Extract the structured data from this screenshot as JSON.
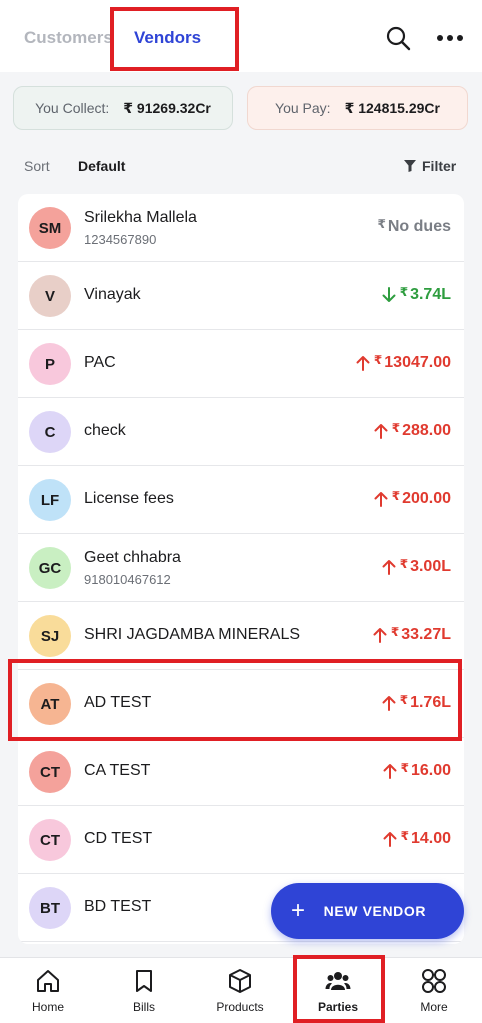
{
  "tabs": {
    "customers": "Customers",
    "vendors": "Vendors"
  },
  "summary": {
    "collect_label": "You Collect:",
    "collect_value": "₹ 91269.32Cr",
    "pay_label": "You Pay:",
    "pay_value": "₹ 124815.29Cr"
  },
  "sort": {
    "label": "Sort",
    "value": "Default",
    "filter_label": "Filter"
  },
  "icons": {
    "search": "search-icon",
    "more": "more-icon",
    "filter": "filter-icon",
    "fab": "plus-icon"
  },
  "colors": {
    "accent": "#2f44d6",
    "outflow": "#e03a2f",
    "inflow": "#2e9d3f",
    "highlight": "#e01f24"
  },
  "vendors": [
    {
      "initials": "SM",
      "name": "Srilekha Mallela",
      "phone": "1234567890",
      "amount": "No dues",
      "direction": "none",
      "avatar_color": "#f4a29b"
    },
    {
      "initials": "V",
      "name": "Vinayak",
      "phone": "",
      "amount": "3.74L",
      "direction": "down",
      "avatar_color": "#e8cfc8"
    },
    {
      "initials": "P",
      "name": "PAC",
      "phone": "",
      "amount": "13047.00",
      "direction": "up",
      "avatar_color": "#f8c8dc"
    },
    {
      "initials": "C",
      "name": "check",
      "phone": "",
      "amount": "288.00",
      "direction": "up",
      "avatar_color": "#ddd6f7"
    },
    {
      "initials": "LF",
      "name": "License fees",
      "phone": "",
      "amount": "200.00",
      "direction": "up",
      "avatar_color": "#bfe2f8"
    },
    {
      "initials": "GC",
      "name": "Geet chhabra",
      "phone": "918010467612",
      "amount": "3.00L",
      "direction": "up",
      "avatar_color": "#c9efc2"
    },
    {
      "initials": "SJ",
      "name": "SHRI JAGDAMBA MINERALS",
      "phone": "",
      "amount": "33.27L",
      "direction": "up",
      "avatar_color": "#f9dc9a"
    },
    {
      "initials": "AT",
      "name": "AD TEST",
      "phone": "",
      "amount": "1.76L",
      "direction": "up",
      "avatar_color": "#f6b592"
    },
    {
      "initials": "CT",
      "name": "CA TEST",
      "phone": "",
      "amount": "16.00",
      "direction": "up",
      "avatar_color": "#f4a29b"
    },
    {
      "initials": "CT",
      "name": "CD TEST",
      "phone": "",
      "amount": "14.00",
      "direction": "up",
      "avatar_color": "#f8c8dc"
    },
    {
      "initials": "BT",
      "name": "BD TEST",
      "phone": "",
      "amount": "",
      "direction": "none",
      "avatar_color": "#ddd6f7"
    }
  ],
  "fab": {
    "label": "NEW VENDOR"
  },
  "nav": [
    {
      "label": "Home",
      "icon": "home-icon",
      "active": false
    },
    {
      "label": "Bills",
      "icon": "bookmark-icon",
      "active": false
    },
    {
      "label": "Products",
      "icon": "box-icon",
      "active": false
    },
    {
      "label": "Parties",
      "icon": "people-icon",
      "active": true
    },
    {
      "label": "More",
      "icon": "grid-icon",
      "active": false
    }
  ]
}
